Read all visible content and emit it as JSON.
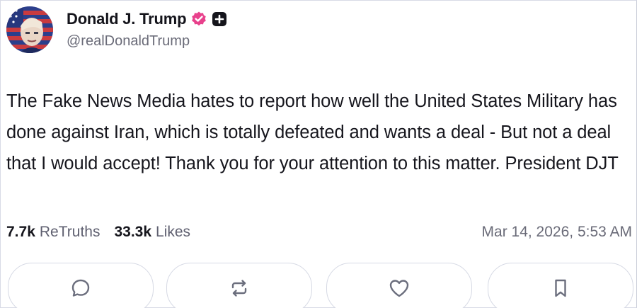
{
  "post": {
    "author": {
      "display_name": "Donald J. Trump",
      "handle": "@realDonaldTrump",
      "avatar_icon": "flag-portrait-avatar",
      "verified_icon": "verified-badge-icon",
      "verified_color": "#e8418c",
      "plus_icon": "plus-square-icon"
    },
    "text": "The Fake News Media hates to report how well the United States Military has done against Iran, which is totally defeated and wants a deal - But not a deal that I would accept! Thank you for your attention to this matter. President DJT",
    "stats": {
      "retruths_count": "7.7k",
      "retruths_label": "ReTruths",
      "likes_count": "33.3k",
      "likes_label": "Likes"
    },
    "timestamp": "Mar 14, 2026, 5:53 AM"
  },
  "actions": {
    "reply_icon": "comment-bubble-icon",
    "retruth_icon": "repost-arrows-icon",
    "like_icon": "heart-icon",
    "bookmark_icon": "bookmark-icon",
    "icon_color": "#6b6e7d"
  }
}
